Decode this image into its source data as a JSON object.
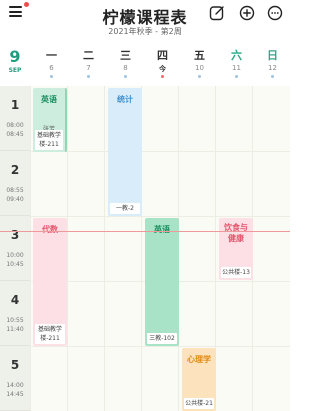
{
  "header": {
    "title": "柠檬课程表",
    "subtitle": "2021年秋季 - 第2周",
    "icons": [
      "menu-icon",
      "edit-icon",
      "add-icon",
      "more-icon"
    ]
  },
  "month": {
    "number": "9",
    "label": "SEP"
  },
  "days": [
    {
      "name": "一",
      "date": "6"
    },
    {
      "name": "二",
      "date": "7"
    },
    {
      "name": "三",
      "date": "8"
    },
    {
      "name": "四",
      "date": "今"
    },
    {
      "name": "五",
      "date": "10"
    },
    {
      "name": "六",
      "date": "11"
    },
    {
      "name": "日",
      "date": "12"
    }
  ],
  "periods": [
    {
      "num": "1",
      "start": "08:00",
      "end": "08:45"
    },
    {
      "num": "2",
      "start": "08:55",
      "end": "09:40"
    },
    {
      "num": "3",
      "start": "10:00",
      "end": "10:45"
    },
    {
      "num": "4",
      "start": "10:55",
      "end": "11:40"
    },
    {
      "num": "5",
      "start": "14:00",
      "end": "14:45"
    }
  ],
  "courses": [
    {
      "name": "英语",
      "teacher": "张芳",
      "room": "基础教学楼-211"
    },
    {
      "name": "统计",
      "room": "一教-2"
    },
    {
      "name": "代数",
      "room": "基础教学楼-211"
    },
    {
      "name": "英语",
      "room": "三教-102"
    },
    {
      "name": "饮食与健康",
      "room": "公共楼-13"
    },
    {
      "name": "心理学",
      "room": "公共楼-21"
    }
  ],
  "colors": {
    "accent": "#1f9e7e",
    "english_bg": "#cdeedf",
    "english_text": "#1e8f60",
    "stats_bg": "#d9ecfa",
    "stats_text": "#3b8fd1",
    "algebra_bg": "#fde0e6",
    "algebra_text": "#e2596e",
    "english2_bg": "#a8e3c8",
    "diet_bg": "#fde0e6",
    "diet_text": "#e2596e",
    "psych_bg": "#fde3bd",
    "psych_text": "#e08a12"
  }
}
